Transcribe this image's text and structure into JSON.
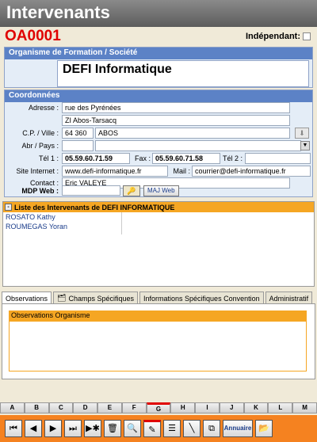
{
  "title": "Intervenants",
  "code": "OA0001",
  "independant_label": "Indépendant:",
  "org": {
    "section": "Organisme de Formation / Société",
    "name": "DEFI Informatique"
  },
  "coords": {
    "section": "Coordonnées",
    "adresse_label": "Adresse :",
    "adresse1": "rue des Pyrénées",
    "adresse2": "ZI Abos-Tarsacq",
    "cp_label": "C.P. / Ville :",
    "cp": "64 360",
    "ville": "ABOS",
    "abr_label": "Abr / Pays :",
    "abr": "",
    "pays": "",
    "tel1_label": "Tél 1 :",
    "tel1": "05.59.60.71.59",
    "fax_label": "Fax :",
    "fax": "05.59.60.71.58",
    "tel2_label": "Tél 2 :",
    "tel2": "",
    "site_label": "Site Internet :",
    "site": "www.defi-informatique.fr",
    "mail_label": "Mail :",
    "mail": "courrier@defi-informatique.fr",
    "contact_label": "Contact :",
    "contact": "Eric VALEYE",
    "mdp_label": "MDP Web :",
    "mdp": "",
    "maj_btn": "MAJ Web"
  },
  "list": {
    "title": "Liste des Intervenants de DEFI INFORMATIQUE",
    "toggle": "-",
    "items": [
      "ROSATO Kathy",
      "ROUMEGAS Yoran"
    ]
  },
  "tabs": [
    {
      "label": "Observations"
    },
    {
      "label": "Champs Spécifiques"
    },
    {
      "label": "Informations Spécifiques Convention"
    },
    {
      "label": "Administratif"
    }
  ],
  "observations_title": "Observations Organisme",
  "alphabet": [
    "A",
    "B",
    "C",
    "D",
    "E",
    "F",
    "G",
    "H",
    "I",
    "J",
    "K",
    "L",
    "M"
  ],
  "alphabet_selected": "G",
  "toolbar": {
    "first": "⏮",
    "prev": "◀",
    "next": "▶",
    "last": "⏭",
    "new": "▶✱",
    "annuaire": "Annuaire"
  },
  "colors": {
    "title_red": "#e00000",
    "section_blue": "#5c82c6",
    "orange": "#f5a623",
    "toolbar_orange": "#f58220"
  }
}
